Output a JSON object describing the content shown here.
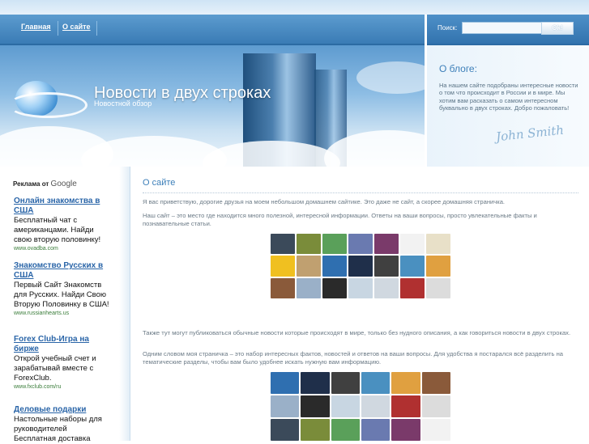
{
  "nav": {
    "items": [
      "Главная",
      "О сайте"
    ]
  },
  "search": {
    "label": "Поиск:",
    "value": "",
    "button": "Ok!"
  },
  "header": {
    "title": "Новости в двух строках",
    "subtitle": "Новостной обзор"
  },
  "blog": {
    "heading": "О блоге:",
    "text": "На нашем сайте подобраны интересные новости о том что происходит в России и в мире. Мы хотим вам расказать о самом интересном буквально в двух строках. Добро пожаловать!",
    "signature": "John Smith"
  },
  "ads": {
    "header_prefix": "Реклама от",
    "header_brand": "Google",
    "items": [
      {
        "title": "Онлайн знакомства в США",
        "desc": "Бесплатный чат с американцами. Найди свою вторую половинку!",
        "url": "www.ovadba.com"
      },
      {
        "title": "Знакомство Русских в США",
        "desc": "Первый Сайт Знакомств для Русских. Найди Свою Вторую Половинку в США!",
        "url": "www.russianhearts.us"
      },
      {
        "title": "Forex Club-Игра на бирже",
        "desc": "Открой учебный счет и зарабатывай вместе с ForexClub.",
        "url": "www.fxclub.com/ru"
      },
      {
        "title": "Деловые подарки",
        "desc": "Настольные наборы для руководителей Бесплатная доставка",
        "url": ""
      }
    ]
  },
  "main": {
    "heading": "О сайте",
    "paragraphs": [
      "Я вас приветствую, дорогие друзья на моем небольшом домашнем сайтике. Это даже не сайт, а скорее домашняя страничка.",
      "Наш сайт – это место где находится много полезной, интересной информации. Ответы на ваши вопросы, просто увлекательные факты и познавательные статьи.",
      "Также тут могут публиковаться обычные новости которые происходят в мире, только без нудного описания, а как говориться новости в двух строках.",
      "Одним словом моя страничка – это набор интересных фактов, новостей и ответов на ваши вопросы. Для удобства я постарался всё разделить на тематические разделы, чтобы вам было удобнее искать нужную вам информацию."
    ]
  },
  "colors": {
    "accent": "#3d7fb9",
    "nav": "#3a7bb5",
    "link": "#2a65a8"
  }
}
